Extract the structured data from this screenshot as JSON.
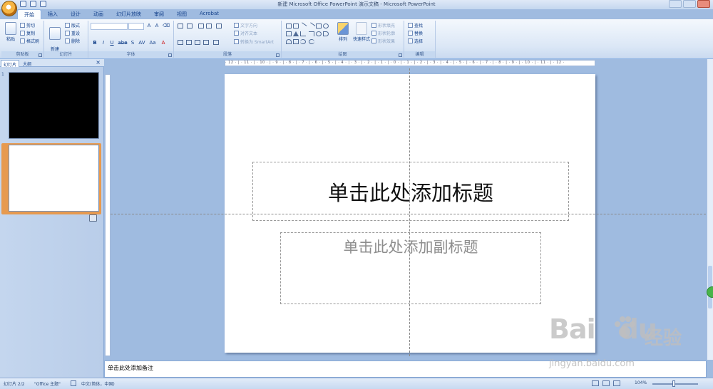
{
  "window": {
    "title": "新建 Microsoft Office PowerPoint 演示文稿 - Microsoft PowerPoint"
  },
  "ribbon": {
    "tabs": [
      "开始",
      "插入",
      "设计",
      "动画",
      "幻灯片放映",
      "审阅",
      "视图",
      "Acrobat"
    ],
    "active_tab": "开始",
    "clipboard": {
      "label": "剪贴板",
      "paste": "粘贴",
      "cut": "剪切",
      "copy": "复制",
      "format_painter": "格式刷"
    },
    "slides": {
      "label": "幻灯片",
      "new_slide": "新建\n幻灯片",
      "layout": "版式",
      "reset": "重设",
      "delete": "删除"
    },
    "font": {
      "label": "字体",
      "font_name": "",
      "font_size": "",
      "bold": "B",
      "italic": "I",
      "underline": "U",
      "strike": "abe",
      "shadow": "S",
      "spacing": "AV",
      "case": "Aa",
      "color": "A"
    },
    "paragraph": {
      "label": "段落",
      "text_direction": "文字方向",
      "align_text": "对齐文本",
      "smartart": "转换为 SmartArt"
    },
    "drawing": {
      "label": "绘图",
      "arrange": "排列",
      "quick_styles": "快速样式",
      "shape_fill": "形状填充",
      "shape_outline": "形状轮廓",
      "shape_effects": "形状效果"
    },
    "editing": {
      "label": "编辑",
      "find": "查找",
      "replace": "替换",
      "select": "选择"
    }
  },
  "left_pane": {
    "tabs": [
      "幻灯片",
      "大纲"
    ],
    "close": "×",
    "slides": [
      {
        "number": "1"
      },
      {
        "number": "2"
      }
    ]
  },
  "ruler": {
    "h_marks": "· 12 · | · 11 · | · 10 · | · 9 · | · 8 · | · 7 · | · 6 · | · 5 · | · 4 · | · 3 · | · 2 · | · 1 · | · 0 · | · 1 · | · 2 · | · 3 · | · 4 · | · 5 · | · 6 · | · 7 · | · 8 · | · 9 · | · 10 · | · 11 · | · 12 ·"
  },
  "slide": {
    "title_placeholder": "单击此处添加标题",
    "subtitle_placeholder": "单击此处添加副标题"
  },
  "notes": {
    "placeholder": "单击此处添加备注"
  },
  "status": {
    "slide_counter": "幻灯片 2/2",
    "theme": "\"Office 主题\"",
    "language": "中文(简体，中国)",
    "zoom": "104%"
  },
  "watermark": {
    "brand": "Bai",
    "brand2": "du",
    "product": "经验",
    "url": "jingyan.baidu.com"
  },
  "colors": {
    "accent": "#15428b",
    "selected_slide": "#e79a4f",
    "ribbon_bg": "#dbe7f6"
  }
}
